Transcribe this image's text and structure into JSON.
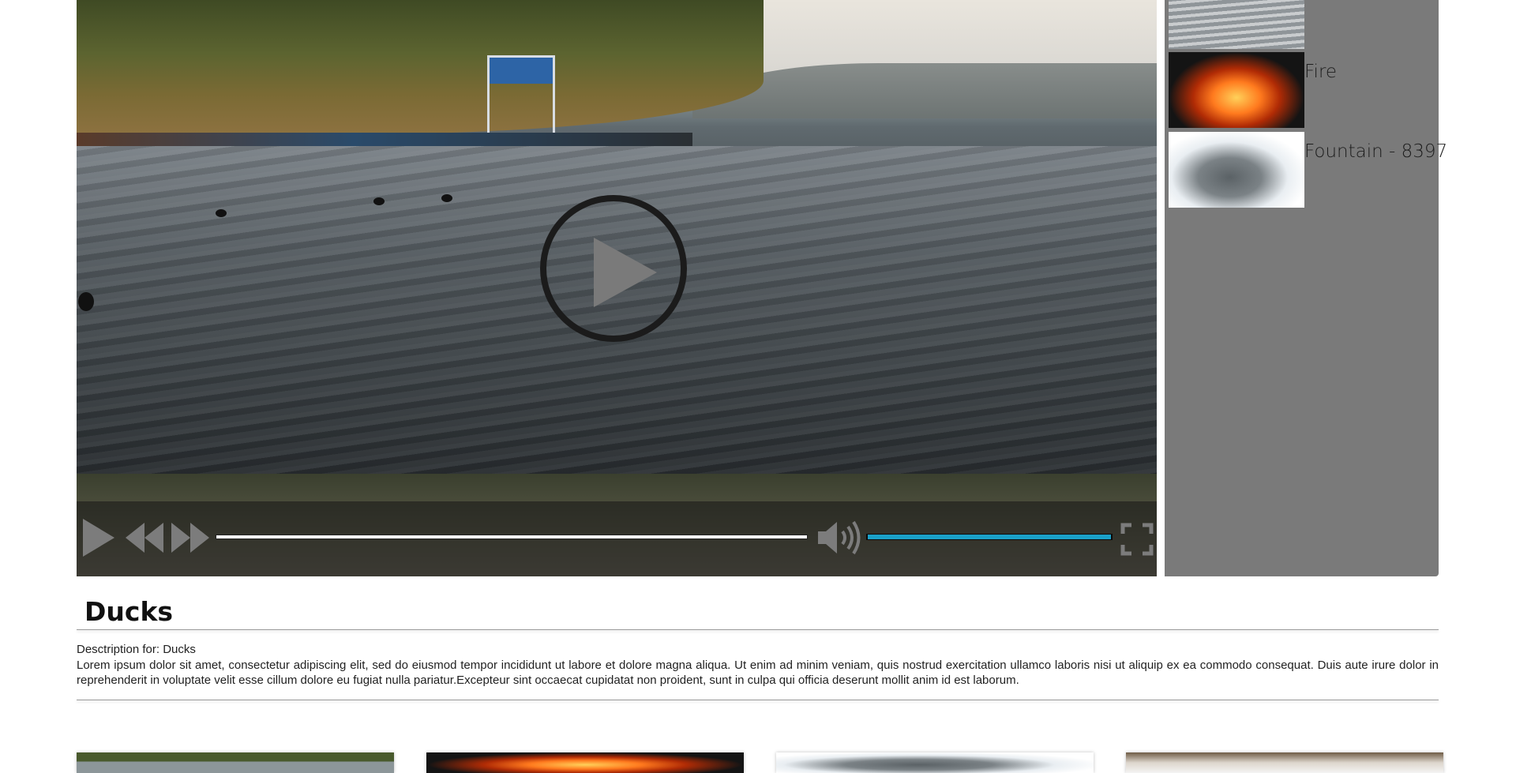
{
  "player": {
    "big_play_icon": "play-circle-icon",
    "controls": {
      "play_icon": "play-icon",
      "rewind_icon": "rewind-icon",
      "forward_icon": "fast-forward-icon",
      "volume_icon": "volume-icon",
      "fullscreen_icon": "fullscreen-icon",
      "progress_fraction": 1.0,
      "volume_fraction": 1.0,
      "accent_color": "#1aa1c9"
    }
  },
  "playlist": {
    "items": [
      {
        "label": "",
        "thumb": "ducks"
      },
      {
        "label": "Fire",
        "thumb": "fire"
      },
      {
        "label": "Fountain - 8397",
        "thumb": "fountain"
      }
    ]
  },
  "video": {
    "title": "Ducks",
    "description_label": "Desctription for: Ducks",
    "description_text": "Lorem ipsum dolor sit amet, consectetur adipiscing elit, sed do eiusmod tempor incididunt ut labore et dolore magna aliqua. Ut enim ad minim veniam, quis nostrud exercitation ullamco laboris nisi ut aliquip ex ea commodo consequat. Duis aute irure dolor in reprehenderit in voluptate velit esse cillum dolore eu fugiat nulla pariatur.Excepteur sint occaecat cupidatat non proident, sunt in culpa qui officia deserunt mollit anim id est laborum."
  },
  "grid": {
    "items": [
      {
        "thumb": "lake"
      },
      {
        "thumb": "fire"
      },
      {
        "thumb": "fountain"
      },
      {
        "thumb": "forest"
      }
    ]
  }
}
